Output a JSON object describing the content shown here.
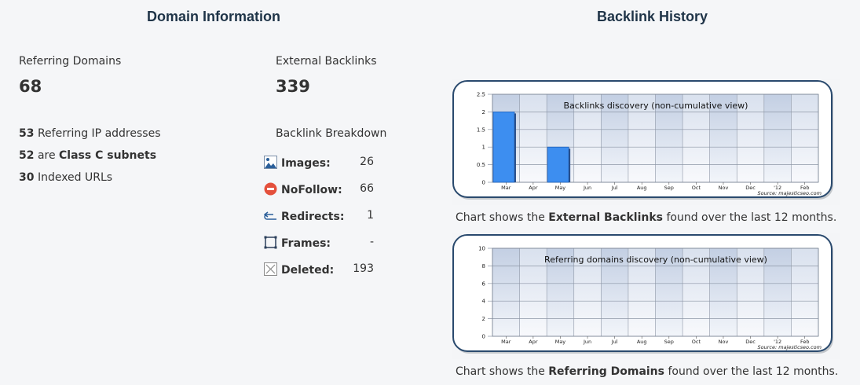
{
  "domain_info": {
    "heading": "Domain Information",
    "referring_domains_label": "Referring Domains",
    "referring_domains_value": "68",
    "external_backlinks_label": "External Backlinks",
    "external_backlinks_value": "339",
    "ip_count": "53",
    "ip_label": "Referring IP addresses",
    "subnet_count": "52",
    "subnet_are": "are",
    "subnet_label": "Class C subnets",
    "indexed_count": "30",
    "indexed_label": "Indexed URLs",
    "breakdown_label": "Backlink Breakdown",
    "breakdown": [
      {
        "name": "Images:",
        "value": "26",
        "icon": "image-icon"
      },
      {
        "name": "NoFollow:",
        "value": "66",
        "icon": "nofollow-icon"
      },
      {
        "name": "Redirects:",
        "value": "1",
        "icon": "redirect-icon"
      },
      {
        "name": "Frames:",
        "value": "-",
        "icon": "frame-icon"
      },
      {
        "name": "Deleted:",
        "value": "193",
        "icon": "deleted-icon"
      }
    ]
  },
  "backlink_history": {
    "heading": "Backlink History",
    "caption1_pre": "Chart shows the",
    "caption1_bold": "External Backlinks",
    "caption1_post": "found over the last 12 months.",
    "caption2_pre": "Chart shows the",
    "caption2_bold": "Referring Domains",
    "caption2_post": "found over the last 12 months."
  },
  "chart_data": [
    {
      "type": "bar",
      "title": "Backlinks discovery (non-cumulative view)",
      "source": "Source: majesticseo.com",
      "categories": [
        "Mar",
        "Apr",
        "May",
        "Jun",
        "Jul",
        "Aug",
        "Sep",
        "Oct",
        "Nov",
        "Dec",
        "'12",
        "Feb"
      ],
      "values": [
        2,
        0,
        1,
        0,
        0,
        0,
        0,
        0,
        0,
        0,
        0,
        0
      ],
      "yticks": [
        "0",
        "0.5",
        "1",
        "1.5",
        "2",
        "2.5"
      ],
      "ylim": [
        0,
        2.5
      ],
      "grid": true,
      "bar_color": "#3d8ef0"
    },
    {
      "type": "bar",
      "title": "Referring domains discovery (non-cumulative view)",
      "source": "Source: majesticseo.com",
      "categories": [
        "Mar",
        "Apr",
        "May",
        "Jun",
        "Jul",
        "Aug",
        "Sep",
        "Oct",
        "Nov",
        "Dec",
        "'12",
        "Feb"
      ],
      "values": [
        0,
        0,
        0,
        0,
        0,
        0,
        0,
        0,
        0,
        0,
        0,
        0
      ],
      "yticks": [
        "0",
        "2",
        "4",
        "6",
        "8",
        "10"
      ],
      "ylim": [
        0,
        10
      ],
      "grid": true,
      "bar_color": "#3d8ef0"
    }
  ]
}
